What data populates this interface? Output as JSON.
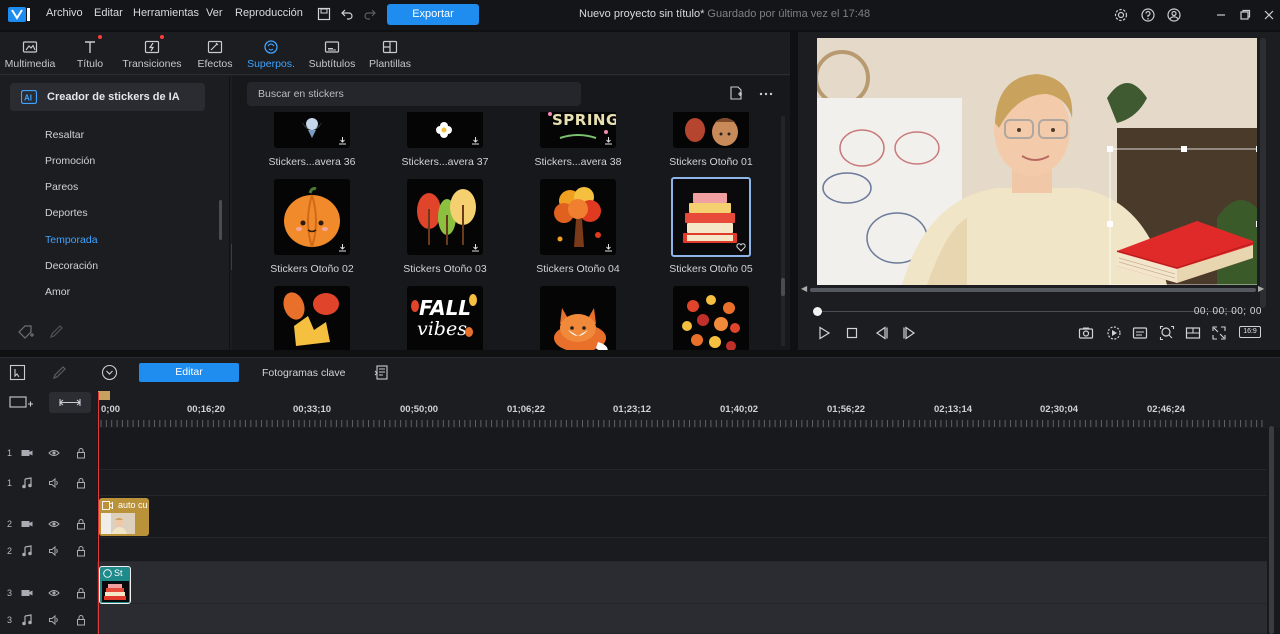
{
  "menubar": {
    "items": [
      "Archivo",
      "Editar",
      "Herramientas",
      "Ver",
      "Reproducción"
    ],
    "export_label": "Exportar",
    "project_title": "Nuevo proyecto sin título*",
    "saved_status": "Guardado por última vez el 17:48"
  },
  "tabs": [
    {
      "label": "Multimedia",
      "icon": "media-icon"
    },
    {
      "label": "Título",
      "icon": "title-icon"
    },
    {
      "label": "Transiciones",
      "icon": "transitions-icon"
    },
    {
      "label": "Efectos",
      "icon": "effects-icon"
    },
    {
      "label": "Superpos.",
      "icon": "overlays-icon",
      "active": true
    },
    {
      "label": "Subtítulos",
      "icon": "subtitles-icon"
    },
    {
      "label": "Plantillas",
      "icon": "templates-icon"
    }
  ],
  "sidebar": {
    "ai_creator_label": "Creador de stickers de IA",
    "categories": [
      "Resaltar",
      "Promoción",
      "Pareos",
      "Deportes",
      "Temporada",
      "Decoración",
      "Amor"
    ],
    "active_category": "Temporada"
  },
  "search": {
    "placeholder": "Buscar en stickers"
  },
  "stickers": [
    {
      "label": "Stickers...avera 36"
    },
    {
      "label": "Stickers...avera 37"
    },
    {
      "label": "Stickers...avera 38"
    },
    {
      "label": "Stickers Otoño 01"
    },
    {
      "label": "Stickers Otoño 02"
    },
    {
      "label": "Stickers Otoño 03"
    },
    {
      "label": "Stickers Otoño 04"
    },
    {
      "label": "Stickers Otoño 05",
      "selected": true
    },
    {
      "label": ""
    },
    {
      "label": ""
    },
    {
      "label": ""
    },
    {
      "label": ""
    }
  ],
  "sticker_texts": {
    "spring": "SPRING",
    "fall": "FALL",
    "vibes": "vibes"
  },
  "preview": {
    "timecode": "00; 00; 00; 00",
    "aspect_ratio": "16:9"
  },
  "timeline_toolbar": {
    "edit_label": "Editar",
    "keyframes_label": "Fotogramas clave"
  },
  "ruler_labels": [
    "0;00",
    "00;16;20",
    "00;33;10",
    "00;50;00",
    "01;06;22",
    "01;23;12",
    "01;40;02",
    "01;56;22",
    "02;13;14",
    "02;30;04",
    "02;46;24"
  ],
  "tracks": [
    {
      "num": "1",
      "type": "video"
    },
    {
      "num": "1",
      "type": "audio"
    },
    {
      "num": "2",
      "type": "video"
    },
    {
      "num": "2",
      "type": "audio"
    },
    {
      "num": "3",
      "type": "video"
    },
    {
      "num": "3",
      "type": "audio"
    }
  ],
  "clips": {
    "video_clip_label": "auto cu",
    "sticker_clip_label": "St"
  },
  "colors": {
    "accent": "#1f8cf0",
    "active_tab": "#3ea3ff",
    "playhead": "#e03a3a",
    "video_clip": "#b9923a",
    "sticker_clip": "#1e8a8a"
  }
}
